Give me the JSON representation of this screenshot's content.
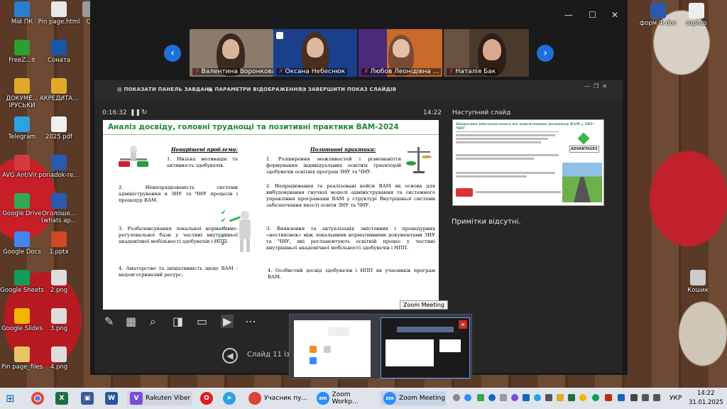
{
  "desktop": {
    "left_icons": [
      {
        "label": "Мій ПК",
        "color": "#2a7fd4"
      },
      {
        "label": "Pin page.html",
        "color": "#e8e8e8"
      },
      {
        "label": "Ca",
        "color": "#999999"
      },
      {
        "label": "FreeZ...it",
        "color": "#2ca02c"
      },
      {
        "label": "Соната",
        "color": "#1a56a8"
      },
      {
        "label": "ДОКУМЕ... ІРУСЬКИ",
        "color": "#e0a92a"
      },
      {
        "label": "АКРЕДИТА...",
        "color": "#e0a92a"
      },
      {
        "label": "Telegram",
        "color": "#2aa3e0"
      },
      {
        "label": "2025.pdf",
        "color": "#f0f0f0"
      },
      {
        "label": "AVG AntiVir...",
        "color": "#d23c3c"
      },
      {
        "label": "poriadok-re...",
        "color": "#2a5ab0"
      },
      {
        "label": "Google Drive",
        "color": "#34a853"
      },
      {
        "label": "Оголоше... (whats ap...",
        "color": "#2a5ab0"
      },
      {
        "label": "Google Docs",
        "color": "#4285f4"
      },
      {
        "label": "1.pptx",
        "color": "#d24726"
      },
      {
        "label": "Google Sheets",
        "color": "#0f9d58"
      },
      {
        "label": "2.png",
        "color": "#dddddd"
      },
      {
        "label": "Google Slides",
        "color": "#f4b400"
      },
      {
        "label": "3.png",
        "color": "#dddddd"
      },
      {
        "label": "Pin page_files",
        "color": "#e8c468"
      },
      {
        "label": "4.png",
        "color": "#dddddd"
      }
    ],
    "right_icons": [
      {
        "label": "форм Ф.doc",
        "color": "#2a5ab0"
      },
      {
        "label": "sophus",
        "color": "#eeeeee"
      },
      {
        "label": "Кошик",
        "color": "#cccccc"
      }
    ]
  },
  "window": {
    "controls": [
      "—",
      "☐",
      "✕"
    ]
  },
  "participants": [
    {
      "name": "Валентина Воронкова",
      "bg": "#7a6a5a"
    },
    {
      "name": "Оксана Небеснюк",
      "bg": "#1b3f8a"
    },
    {
      "name": "Любов Леонідівна ...",
      "bg": "#c86a2a"
    },
    {
      "name": "Наталія Бак",
      "bg": "#4a3a2e"
    }
  ],
  "presenter": {
    "toolbar": {
      "show_taskbar": "ПОКАЗАТИ ПАНЕЛЬ ЗАВДАНЬ",
      "display_settings": "ПАРАМЕТРИ ВІДОБРАЖЕННЯ ▾",
      "end_show": "ЗАВЕРШИТИ ПОКАЗ СЛАЙДІВ"
    },
    "timer": "0:16:32",
    "clock": "14:22",
    "next_slide_label": "Наступний слайд",
    "notes": "Примітки відсутні.",
    "slide_counter": "Слайд 11 із"
  },
  "slide": {
    "title": "Аналіз досвіду, головні труднощі та позитивні практики ВАМ-2024",
    "left_head": "Невирішені проблеми:",
    "right_head": "Позитивні практики:",
    "left": [
      "1. Низька мотивація та активність здобувачів.",
      "2. Невпорядкованість системи адміністрування в ЗНУ та ЧНУ процесів і процедур ВАМ.",
      "3. Розбалансування локальної нормативно-регуловальної бази у частині внутрішньої академічної мобільності здобувачів і НПП.",
      "4. Аматорство та ініціативність щодо ВАМ - недовготривалий ресурс."
    ],
    "right": [
      "1. Розширення можливостей і різноманіття формування індивідуальних освітніх траєкторій здобувачів освітніх програм ЗНУ та ЧНУ.",
      "2. Напрацювання та реалізовані кейси ВАМ як основа для вибудовування гнучкої моделі адміністрування та системного управління програмами ВАМ у структурі Внутрішньої системи забезпечення якості освіти ЗНУ та ЧНУ.",
      "3. Виявлення та актуалізація змістовних і процедурних «нестиковок» між локальними нормативними документами ЗНУ та ЧНУ, які регламентують освітній процес у частині внутрішньої академічної мобільності здобувачів і НПП.",
      "4. Особистий досвід здобувачів і НПП як учасників програм ВАМ."
    ]
  },
  "next_slide": {
    "title": "Напрямки вдосконалення та перспективи розвитку ВАМ у ЗНУ-ЧНУ",
    "badge": "ADVANTAGES"
  },
  "tooltip": "Zoom Meeting",
  "taskbar": {
    "items": [
      {
        "label": "Rakuten Viber",
        "color": "#7d4cdb"
      },
      {
        "label": "Учасник пу...",
        "color": "#db4437"
      },
      {
        "label": "Zoom Workp...",
        "color": "#2d8cff"
      },
      {
        "label": "Zoom Meeting",
        "color": "#2d8cff"
      }
    ],
    "lang": "УКР",
    "time": "14:22",
    "date": "31.01.2025"
  }
}
